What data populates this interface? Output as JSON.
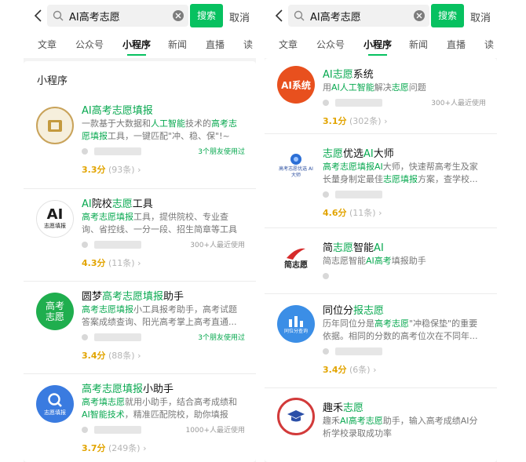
{
  "left": {
    "search": {
      "query": "AI高考志愿",
      "button": "搜索",
      "cancel": "取消"
    },
    "tabs": [
      "文章",
      "公众号",
      "小程序",
      "新闻",
      "直播",
      "读"
    ],
    "active_tab": "小程序",
    "section_label": "小程序",
    "items": [
      {
        "logo_text": "",
        "title": [
          {
            "t": "AI高考志愿填报",
            "h": true
          }
        ],
        "desc": [
          {
            "t": "一款基于大数据和",
            "h": false
          },
          {
            "t": "人工智能",
            "h": true
          },
          {
            "t": "技术的",
            "h": false
          },
          {
            "t": "高考志愿填报",
            "h": true
          },
          {
            "t": "工具，一键匹配\"冲、稳、保\"!~",
            "h": false
          }
        ],
        "usage": "3个朋友使用过",
        "score": "3.3分",
        "count": "(93条)"
      },
      {
        "logo_text": "志愿填报",
        "title": [
          {
            "t": "AI",
            "h": true
          },
          {
            "t": "院校",
            "h": false
          },
          {
            "t": "志愿",
            "h": true
          },
          {
            "t": "工具",
            "h": false
          }
        ],
        "desc": [
          {
            "t": "高考志愿填报",
            "h": true
          },
          {
            "t": "工具，提供院校、专业查询、省控线、一分一段、招生简章等工具",
            "h": false
          }
        ],
        "usage": "300+人最近使用",
        "score": "4.3分",
        "count": "(11条)"
      },
      {
        "logo_text": "高考志愿",
        "title": [
          {
            "t": "圆梦",
            "h": false
          },
          {
            "t": "高考志愿填报",
            "h": true
          },
          {
            "t": "助手",
            "h": false
          }
        ],
        "desc": [
          {
            "t": "高考志愿填报",
            "h": true
          },
          {
            "t": "小工具报考助手，高考试题答案成绩查询、阳光高考掌上高考直通...",
            "h": false
          }
        ],
        "usage": "3个朋友使用过",
        "score": "3.4分",
        "count": "(88条)"
      },
      {
        "logo_text": "志愿填报",
        "title": [
          {
            "t": "高考志愿填报",
            "h": true
          },
          {
            "t": "小助手",
            "h": false
          }
        ],
        "desc": [
          {
            "t": "高考填志愿",
            "h": true
          },
          {
            "t": "就用小助手，结合高考成绩和",
            "h": false
          },
          {
            "t": "AI智能技术",
            "h": true
          },
          {
            "t": "，精准匹配院校，助你填报志...",
            "h": false
          }
        ],
        "usage": "1000+人最近使用",
        "score": "3.7分",
        "count": "(249条)"
      }
    ]
  },
  "right": {
    "search": {
      "query": "AI高考志愿",
      "button": "搜索",
      "cancel": "取消"
    },
    "tabs": [
      "文章",
      "公众号",
      "小程序",
      "新闻",
      "直播",
      "读"
    ],
    "active_tab": "小程序",
    "items": [
      {
        "logo_text": "AI系统",
        "title": [
          {
            "t": "AI志愿",
            "h": true
          },
          {
            "t": "系统",
            "h": false
          }
        ],
        "desc": [
          {
            "t": "用",
            "h": false
          },
          {
            "t": "AI人工智能",
            "h": true
          },
          {
            "t": "解决",
            "h": false
          },
          {
            "t": "志愿",
            "h": true
          },
          {
            "t": "问题",
            "h": false
          }
        ],
        "usage": "300+人最近使用",
        "score": "3.1分",
        "count": "(302条)"
      },
      {
        "logo_text": "高考志愿优选 AI大师",
        "title": [
          {
            "t": "志愿",
            "h": true
          },
          {
            "t": "优选",
            "h": false
          },
          {
            "t": "AI",
            "h": true
          },
          {
            "t": "大师",
            "h": false
          }
        ],
        "desc": [
          {
            "t": "高考志愿填报AI",
            "h": true
          },
          {
            "t": "大师，快速帮高考生及家长量身制定最佳",
            "h": false
          },
          {
            "t": "志愿填报",
            "h": true
          },
          {
            "t": "方案，查学校...",
            "h": false
          }
        ],
        "usage": "",
        "score": "4.6分",
        "count": "(11条)"
      },
      {
        "logo_text": "简志愿",
        "title": [
          {
            "t": "简",
            "h": false
          },
          {
            "t": "志愿",
            "h": true
          },
          {
            "t": "智能",
            "h": false
          },
          {
            "t": "AI",
            "h": true
          }
        ],
        "desc": [
          {
            "t": "简志愿智能",
            "h": false
          },
          {
            "t": "AI高考",
            "h": true
          },
          {
            "t": "填报助手",
            "h": false
          }
        ],
        "usage": "",
        "score": "",
        "count": ""
      },
      {
        "logo_text": "同位分查询",
        "title": [
          {
            "t": "同位分",
            "h": false
          },
          {
            "t": "报志愿",
            "h": true
          }
        ],
        "desc": [
          {
            "t": "历年同位分是",
            "h": false
          },
          {
            "t": "高考志愿",
            "h": true
          },
          {
            "t": "\"冲稳保垫\"的重要依据。相同的分数的高考位次在不同年...",
            "h": false
          }
        ],
        "usage": "",
        "score": "3.4分",
        "count": "(6条)"
      },
      {
        "logo_text": "",
        "title": [
          {
            "t": "趣禾",
            "h": false
          },
          {
            "t": "志愿",
            "h": true
          }
        ],
        "desc": [
          {
            "t": "趣禾",
            "h": false
          },
          {
            "t": "AI高考志愿",
            "h": true
          },
          {
            "t": "助手，输入高考成绩AI分析学校录取成功率",
            "h": false
          }
        ],
        "usage": "",
        "score": "",
        "count": ""
      }
    ]
  },
  "colors": {
    "accent": "#07c160",
    "highlight": "#07a84f",
    "score": "#e2a400"
  }
}
